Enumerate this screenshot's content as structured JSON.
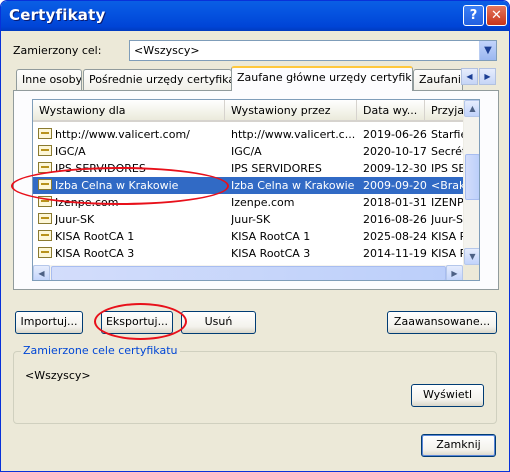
{
  "window": {
    "title": "Certyfikaty"
  },
  "purpose": {
    "label": "Zamierzony cel:",
    "value": "<Wszyscy>"
  },
  "tabs": [
    {
      "label": "Inne osoby"
    },
    {
      "label": "Pośrednie urzędy certyfikacji"
    },
    {
      "label": "Zaufane główne urzędy certyfikacji"
    },
    {
      "label": "Zaufani w"
    }
  ],
  "table": {
    "columns": [
      "Wystawiony dla",
      "Wystawiony przez",
      "Data wy...",
      "Przyjazn"
    ],
    "rows": [
      {
        "issued_to": "http://www.valicert.com/",
        "issued_by": "http://www.valicert.c...",
        "date": "2019-06-26",
        "friendly": "Starfield"
      },
      {
        "issued_to": "IGC/A",
        "issued_by": "IGC/A",
        "date": "2020-10-17",
        "friendly": "Secrétar"
      },
      {
        "issued_to": "IPS SERVIDORES",
        "issued_by": "IPS SERVIDORES",
        "date": "2009-12-30",
        "friendly": "IPS SERV"
      },
      {
        "issued_to": "Izba Celna w Krakowie",
        "issued_by": "Izba Celna w Krakowie",
        "date": "2009-09-20",
        "friendly": "<Brak>"
      },
      {
        "issued_to": "Izenpe.com",
        "issued_by": "Izenpe.com",
        "date": "2018-01-31",
        "friendly": "IZENPE S"
      },
      {
        "issued_to": "Juur-SK",
        "issued_by": "Juur-SK",
        "date": "2016-08-26",
        "friendly": "Juur-SK"
      },
      {
        "issued_to": "KISA RootCA 1",
        "issued_by": "KISA RootCA 1",
        "date": "2025-08-24",
        "friendly": "KISA Roo"
      },
      {
        "issued_to": "KISA RootCA 3",
        "issued_by": "KISA RootCA 3",
        "date": "2014-11-19",
        "friendly": "KISA Roo"
      }
    ]
  },
  "buttons": {
    "import": "Importuj...",
    "export": "Eksportuj...",
    "remove": "Usuń",
    "advanced": "Zaawansowane...",
    "view": "Wyświetl",
    "close": "Zamknij"
  },
  "purposes_group": {
    "title": "Zamierzone cele certyfikatu",
    "value": "<Wszyscy>"
  }
}
